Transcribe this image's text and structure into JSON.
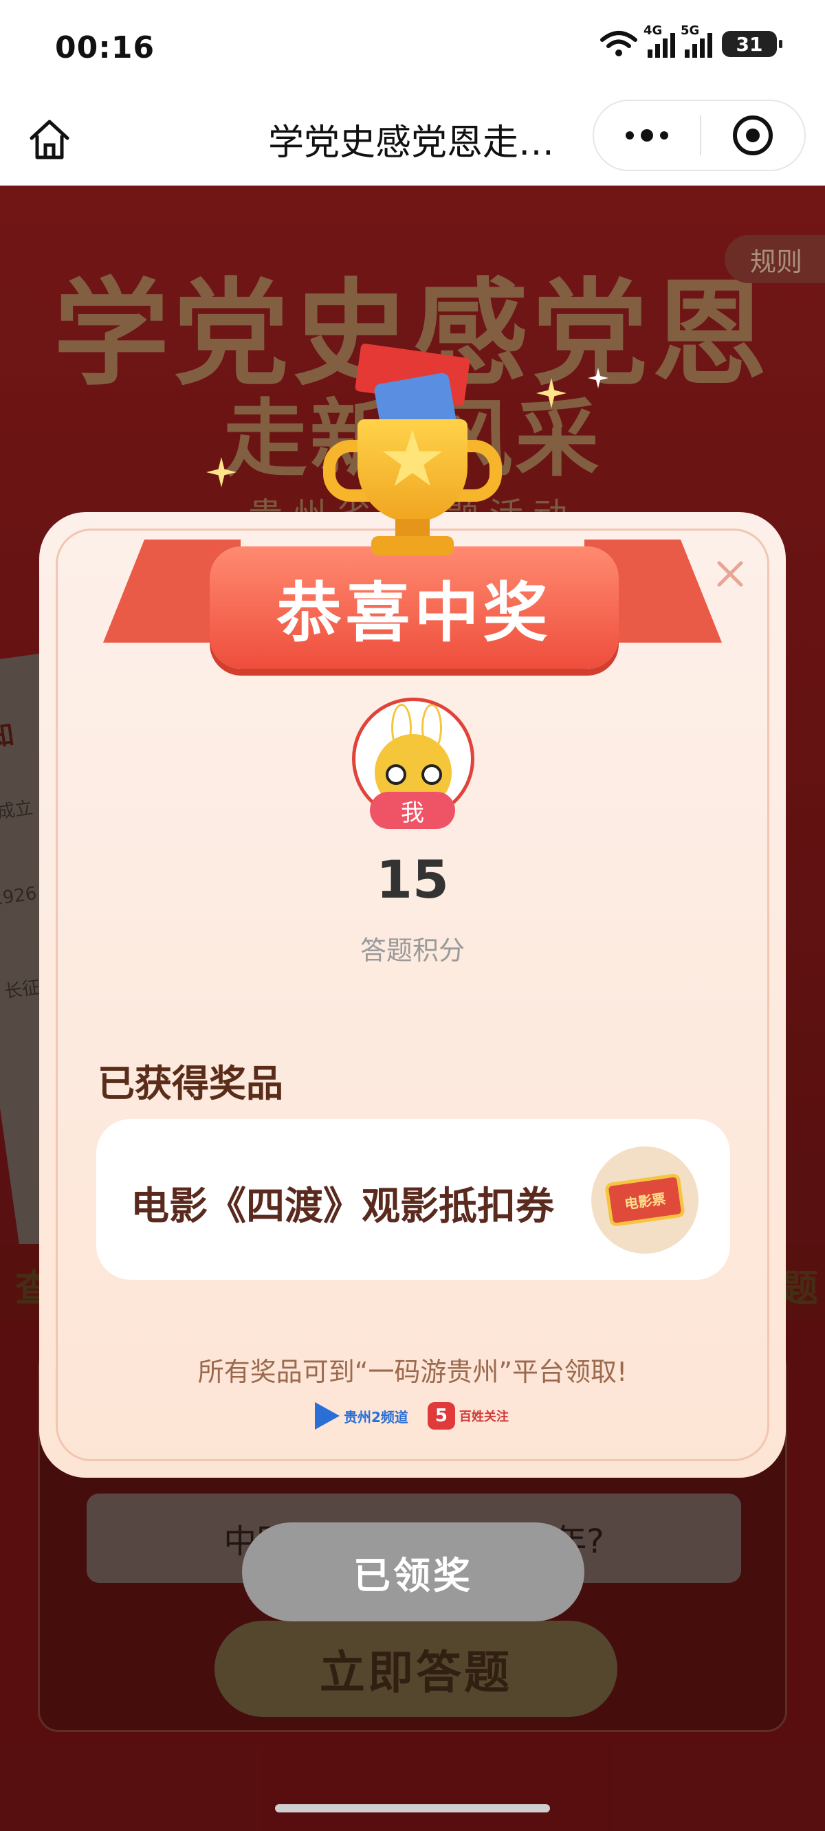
{
  "status_bar": {
    "time": "00:16",
    "network_1": "4G",
    "network_2": "5G",
    "battery": "31"
  },
  "nav_bar": {
    "title": "学党史感党恩走…",
    "home_icon": "home-icon",
    "more_icon": "more-dots-icon",
    "close_icon": "target-close-icon"
  },
  "background": {
    "title": "学党史感党恩",
    "subtitle": "走新 风采",
    "line": "贵州省宝 题活动",
    "rules": "规则",
    "paper_lines": [
      "· 知",
      "国成立",
      "1926",
      "长征"
    ],
    "band_left": "查",
    "band_right": "题",
    "question": "中国共产党成立于哪一年?",
    "answer_button": "立即答题"
  },
  "modal": {
    "banner": "恭喜中奖",
    "me_badge": "我",
    "score": "15",
    "score_label": "答题积分",
    "prize_heading": "已获得奖品",
    "prize_name": "电影《四渡》观影抵扣券",
    "ticket_label": "电影票",
    "claim_note": "所有奖品可到“一码游贵州”平台领取!",
    "logo_1": "贵州2频道",
    "logo_2_mark": "5",
    "logo_2": "百姓关注",
    "claimed_button": "已领奖"
  },
  "colors": {
    "background_red": "#711314",
    "ribbon_red": "#ee4e3c",
    "badge_pink": "#ef5466",
    "claimed_gray": "#9a9a9a",
    "prize_text": "#5a2a1f"
  }
}
